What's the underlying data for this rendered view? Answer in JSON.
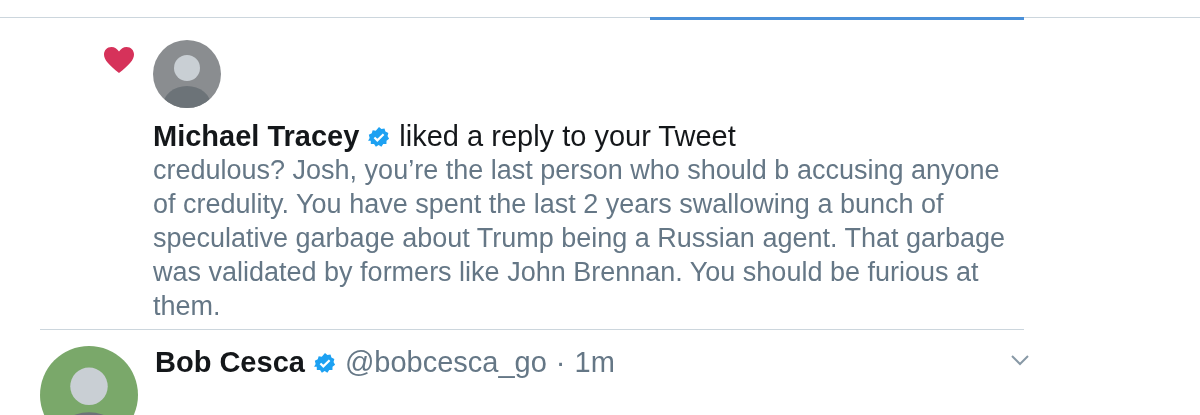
{
  "tabs": [
    {
      "selected": true
    }
  ],
  "notification": {
    "kind": "like",
    "actor": "Michael Tracey",
    "verified": true,
    "action": "liked a reply to your Tweet",
    "body_lines": [
      "credulous? Josh, you’re the last person who should b accusing anyone",
      "of credulity. You have spent the last 2 years swallowing a bunch of",
      "speculative garbage about Trump being a Russian agent. That garbage",
      "was validated by formers like John Brennan. You should be furious at",
      "them."
    ]
  },
  "tweet": {
    "name": "Bob Cesca",
    "verified": true,
    "handle": "@bobcesca_go",
    "separator": "·",
    "time": "1m"
  }
}
